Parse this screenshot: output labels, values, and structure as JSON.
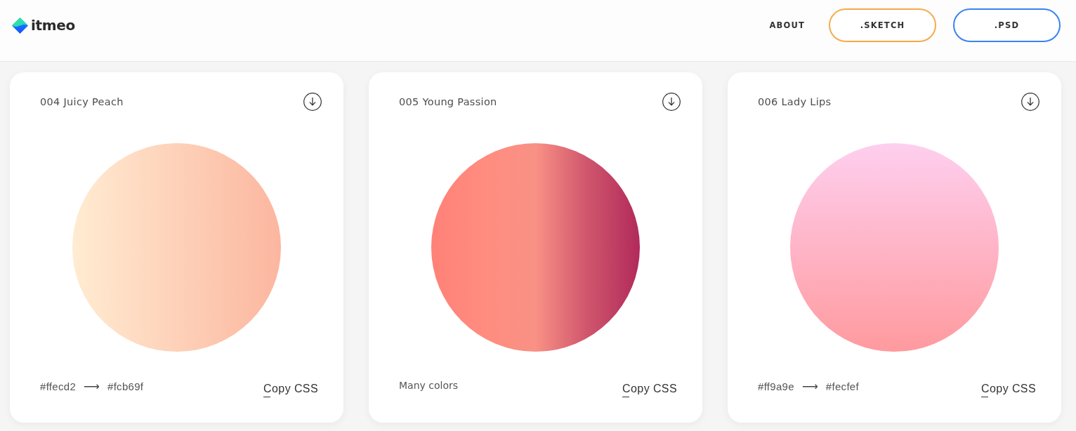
{
  "header": {
    "logo": "itmeo",
    "nav": [
      {
        "label": "ABOUT",
        "kind": "link"
      },
      {
        "label": ".SKETCH",
        "kind": "outline",
        "color": "#f5aa4c"
      },
      {
        "label": ".PSD",
        "kind": "outline",
        "color": "#3a83f1"
      }
    ]
  },
  "cards": [
    {
      "title": "004 Juicy Peach",
      "gradient": {
        "kind": "horizontal",
        "stops": [
          {
            "color": "#ffecd2"
          },
          {
            "color": "#fcb69f"
          }
        ]
      },
      "kind": "pair",
      "from": "#ffecd2",
      "arrow": "⟶",
      "to": "#fcb69f",
      "copy_label": "Copy CSS"
    },
    {
      "title": "005 Young Passion",
      "gradient": {
        "kind": "horizontal",
        "stops": [
          {
            "color": "#ff8177"
          },
          {
            "color": "#ff8c7f"
          },
          {
            "color": "#f99185"
          },
          {
            "color": "#cf556c"
          },
          {
            "color": "#b12a5b"
          }
        ]
      },
      "kind": "note",
      "note": "Many colors",
      "copy_label": "Copy CSS"
    },
    {
      "title": "006 Lady Lips",
      "gradient": {
        "kind": "vertical",
        "stops": [
          {
            "color": "#ff9a9e"
          },
          {
            "color": "#fecfef"
          }
        ]
      },
      "kind": "pair",
      "from": "#ff9a9e",
      "arrow": "⟶",
      "to": "#fecfef",
      "copy_label": "Copy CSS"
    }
  ]
}
